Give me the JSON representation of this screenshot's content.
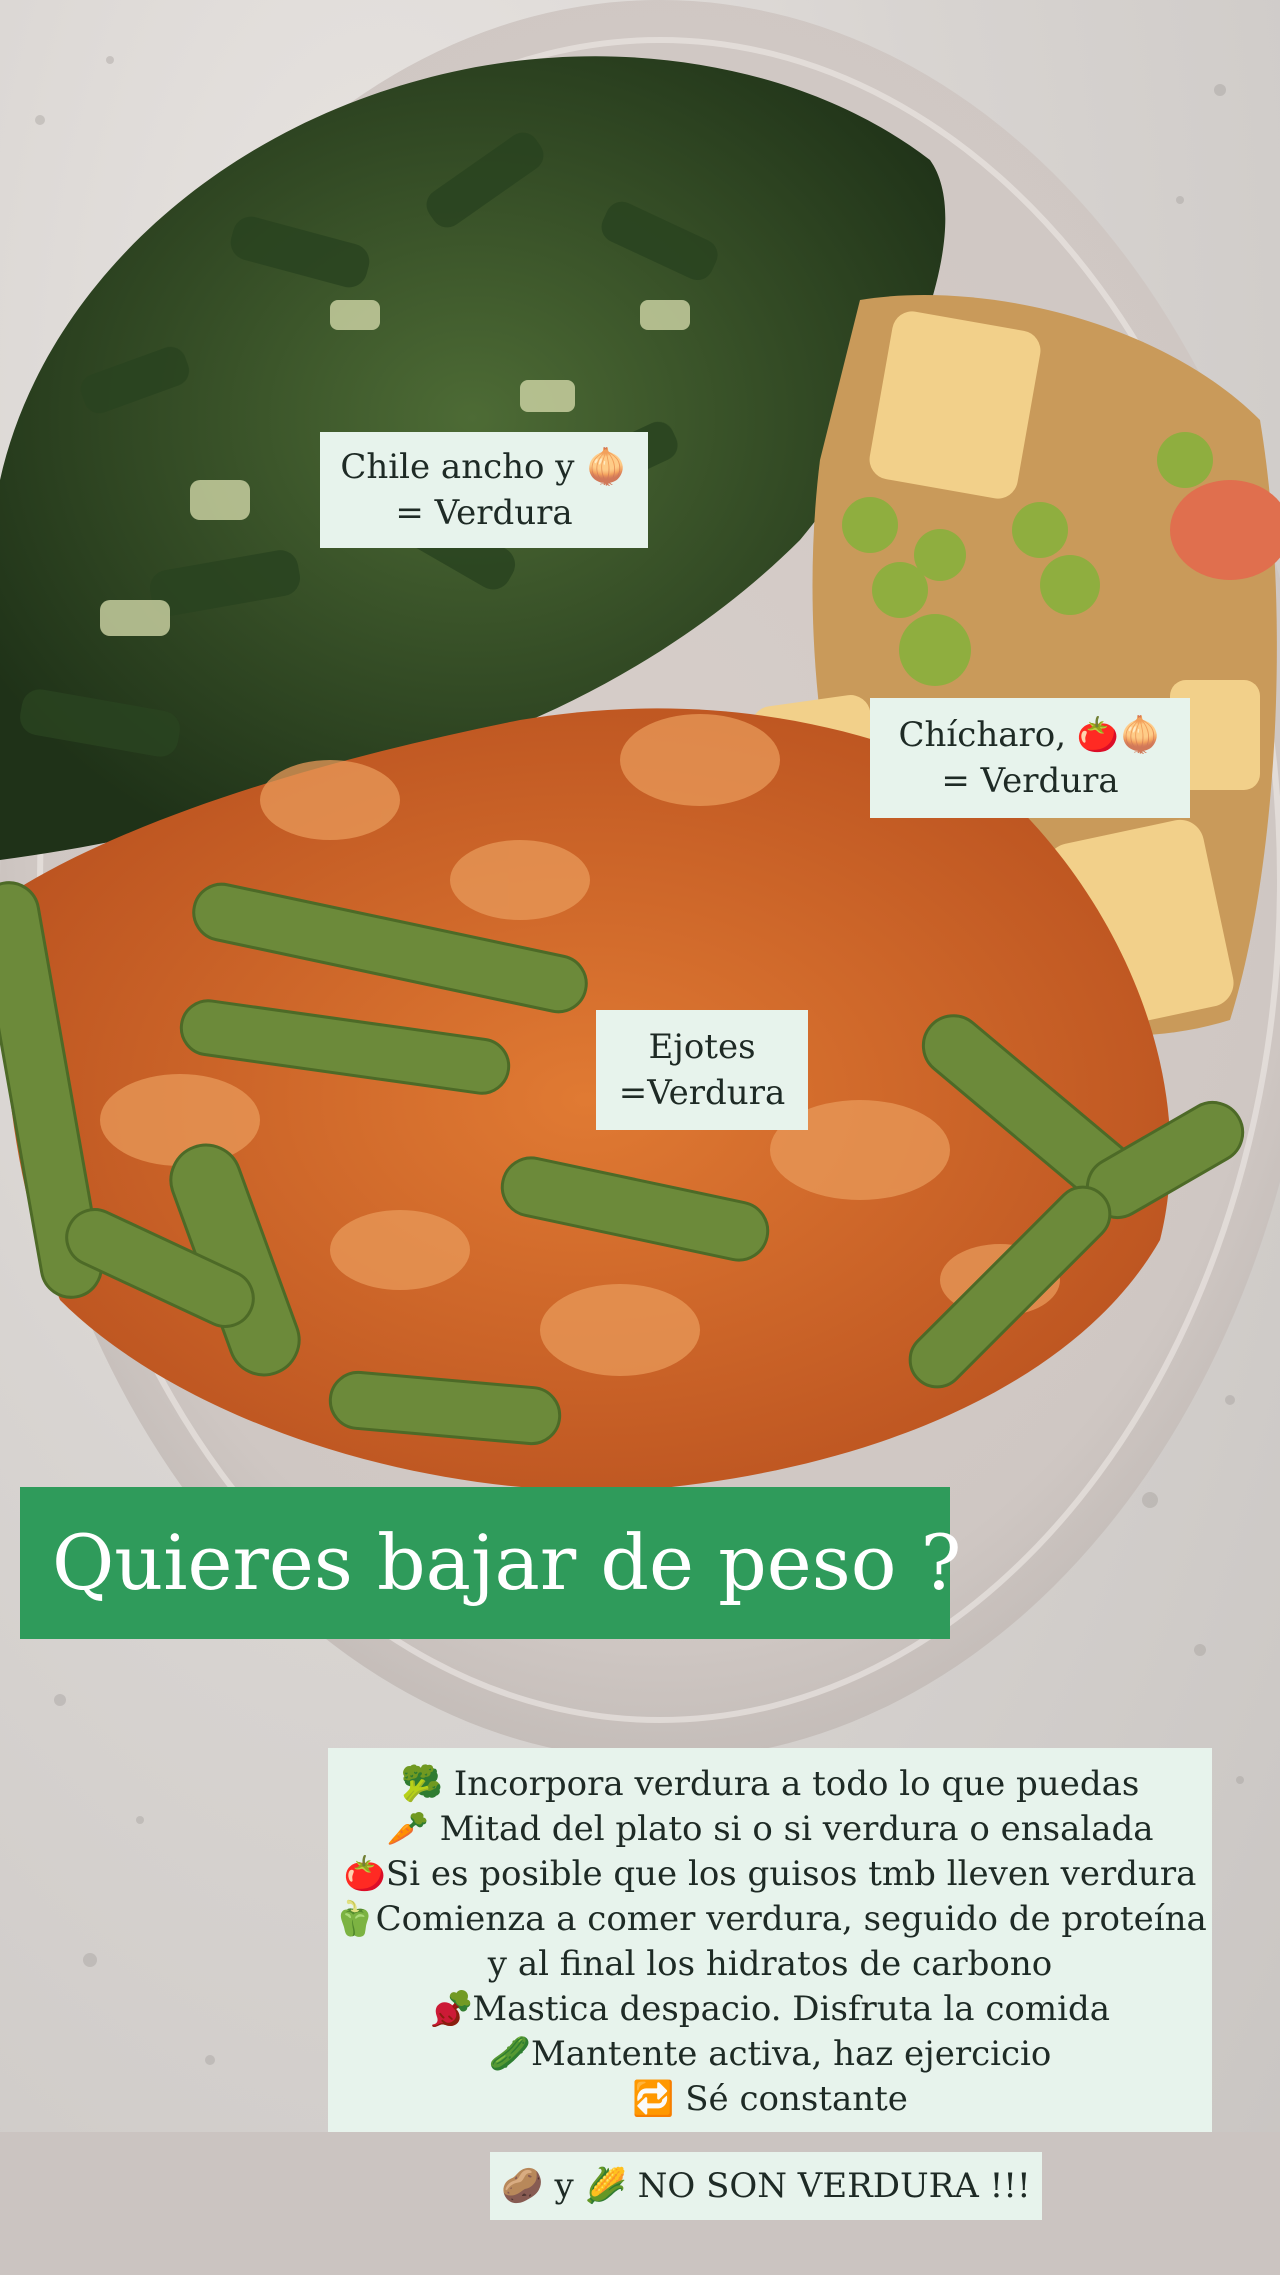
{
  "labels": {
    "chile": [
      "Chile ancho y 🧅",
      "= Verdura"
    ],
    "chicharo": [
      "Chícharo, 🍅🧅",
      "= Verdura"
    ],
    "ejotes": [
      "Ejotes",
      "=Verdura"
    ]
  },
  "banner": "Quieres bajar de peso ?",
  "tips": [
    "🥦 Incorpora verdura a todo lo que puedas",
    "🥕 Mitad del plato si o si verdura o ensalada",
    "🍅Si es posible que los guisos tmb lleven verdura",
    "🫑Comienza a comer verdura, seguido de proteína",
    "y al final los hidratos de carbono",
    "🫜Mastica despacio. Disfruta la comida",
    "🥒Mantente activa, haz ejercicio",
    "🔁 Sé constante"
  ],
  "footer_note": "🥔 y 🌽 NO SON VERDURA !!!",
  "colors": {
    "banner_green": "#2f9b5b",
    "label_bg": "#e7f3ec",
    "plate": "#d9d2cf",
    "poblano": "#2f4a26",
    "ejote": "#6c8a3a",
    "salsa": "#d2692a",
    "papa": "#f2d08a",
    "chicharo": "#8fae3f"
  }
}
